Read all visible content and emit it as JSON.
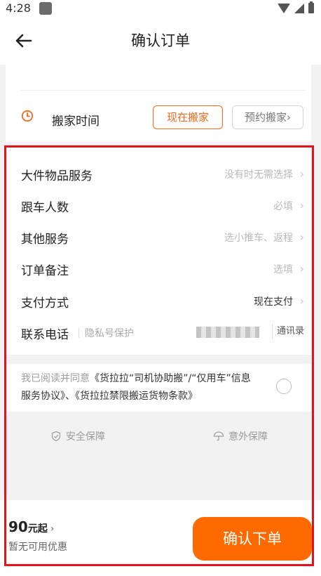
{
  "status_bar": {
    "time": "4:28"
  },
  "header": {
    "title": "确认订单"
  },
  "move_time": {
    "label": "搬家时间",
    "now_button": "现在搬家",
    "reserve_button": "预约搬家",
    "reserve_chevron": "›"
  },
  "form": {
    "items": [
      {
        "label": "大件物品服务",
        "value": "没有时无需选择",
        "chevron": "›"
      },
      {
        "label": "跟车人数",
        "value": "必填",
        "chevron": "›"
      },
      {
        "label": "其他服务",
        "value": "选小推车、返程",
        "chevron": "›"
      },
      {
        "label": "订单备注",
        "value": "选填",
        "chevron": "›"
      },
      {
        "label": "支付方式",
        "value": "现在支付",
        "chevron": "›"
      }
    ],
    "phone": {
      "label": "联系电话",
      "privacy_note": "隐私号保护",
      "contacts_button": "通讯录"
    }
  },
  "agreement": {
    "prefix": "我已阅读并同意",
    "link1": "《货拉拉“司机协助搬”/“仅用车”信息服务协议》",
    "separator": "、",
    "link2": "《货拉拉禁限搬运货物条款》"
  },
  "guarantees": {
    "safety": "安全保障",
    "accident": "意外保障"
  },
  "footer": {
    "price": "90",
    "price_suffix": "元起",
    "price_chevron": "›",
    "coupon": "暂无可用优惠",
    "confirm": "确认下单"
  },
  "colors": {
    "accent": "#ff6a00",
    "outline": "#f06a1d",
    "highlight": "#e0141b"
  }
}
